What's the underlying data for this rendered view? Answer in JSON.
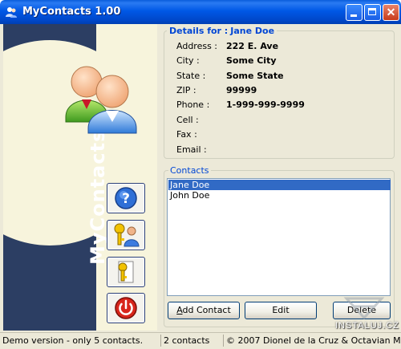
{
  "window": {
    "title": "MyContacts 1.00"
  },
  "brand": "MyContacts",
  "details": {
    "legend_label": "Details for :",
    "legend_name": "Jane Doe",
    "fields": [
      {
        "label": "Address :",
        "value": "222 E. Ave"
      },
      {
        "label": "City :",
        "value": "Some City"
      },
      {
        "label": "State :",
        "value": "Some State"
      },
      {
        "label": "ZIP :",
        "value": "99999"
      },
      {
        "label": "Phone :",
        "value": "1-999-999-9999"
      },
      {
        "label": "Cell :",
        "value": ""
      },
      {
        "label": "Fax :",
        "value": ""
      },
      {
        "label": "Email :",
        "value": ""
      }
    ]
  },
  "contacts": {
    "legend": "Contacts",
    "items": [
      "Jane Doe",
      "John Doe"
    ],
    "selected": "Jane Doe",
    "add_label": "Add Contact",
    "edit_label": "Edit",
    "delete_label": "Delete"
  },
  "sidebar": {
    "buttons": [
      {
        "icon": "help-icon"
      },
      {
        "icon": "keys-user-icon"
      },
      {
        "icon": "key-icon"
      },
      {
        "icon": "power-icon"
      }
    ]
  },
  "status": [
    "Demo version - only 5 contacts.",
    "2 contacts",
    "© 2007 Dionel de la Cruz & Octavian Merches"
  ],
  "watermark": "INSTALUJ.CZ",
  "colors": {
    "titlebar": "#0058e6",
    "sidebar": "#2c3e63",
    "cream": "#f7f4dc",
    "accent": "#0046d5",
    "selection": "#316ac5"
  }
}
